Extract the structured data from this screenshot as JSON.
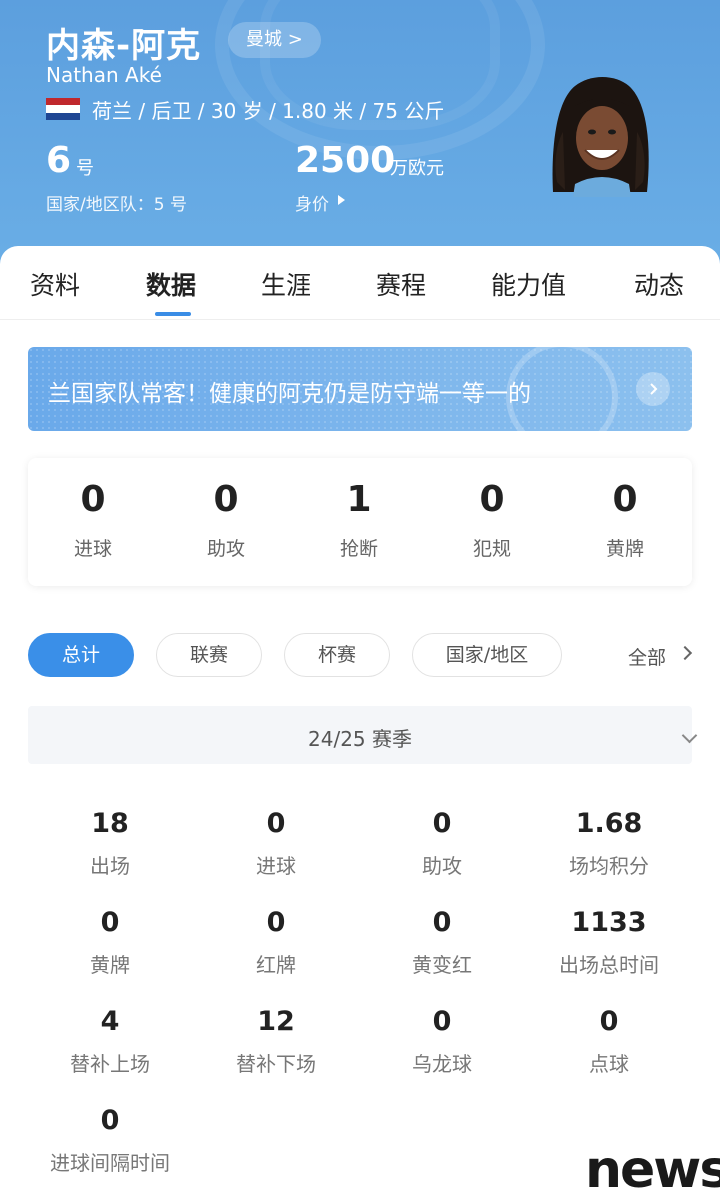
{
  "header": {
    "name_cn": "内森-阿克",
    "club": "曼城 >",
    "name_en": "Nathan Aké",
    "info": "荷兰 / 后卫 / 30 岁 / 1.80 米 / 75 公斤",
    "shirt_number": "6",
    "shirt_unit": "号",
    "national_team": "国家/地区队：5 号",
    "market_value": "2500",
    "market_value_unit": "万欧元",
    "market_value_label": "身价"
  },
  "tabs": [
    "资料",
    "数据",
    "生涯",
    "赛程",
    "能力值",
    "动态"
  ],
  "active_tab": "数据",
  "banner": {
    "text": "兰国家队常客！健康的阿克仍是防守端一等一的"
  },
  "recent": [
    {
      "value": "0",
      "label": "进球"
    },
    {
      "value": "0",
      "label": "助攻"
    },
    {
      "value": "1",
      "label": "抢断"
    },
    {
      "value": "0",
      "label": "犯规"
    },
    {
      "value": "0",
      "label": "黄牌"
    }
  ],
  "filters": [
    "总计",
    "联赛",
    "杯赛",
    "国家/地区"
  ],
  "active_filter": "总计",
  "all_link": "全部",
  "season": "24/25 赛季",
  "stats": [
    {
      "value": "18",
      "label": "出场"
    },
    {
      "value": "0",
      "label": "进球"
    },
    {
      "value": "0",
      "label": "助攻"
    },
    {
      "value": "1.68",
      "label": "场均积分"
    },
    {
      "value": "0",
      "label": "黄牌"
    },
    {
      "value": "0",
      "label": "红牌"
    },
    {
      "value": "0",
      "label": "黄变红"
    },
    {
      "value": "1133",
      "label": "出场总时间"
    },
    {
      "value": "4",
      "label": "替补上场"
    },
    {
      "value": "12",
      "label": "替补下场"
    },
    {
      "value": "0",
      "label": "乌龙球"
    },
    {
      "value": "0",
      "label": "点球"
    },
    {
      "value": "0",
      "label": "进球间隔时间"
    }
  ],
  "watermark": "news",
  "colors": {
    "header_bg": "#5c9fde",
    "accent": "#3a8fe8",
    "flag": [
      "#c0282d",
      "#ffffff",
      "#1f4693"
    ]
  }
}
